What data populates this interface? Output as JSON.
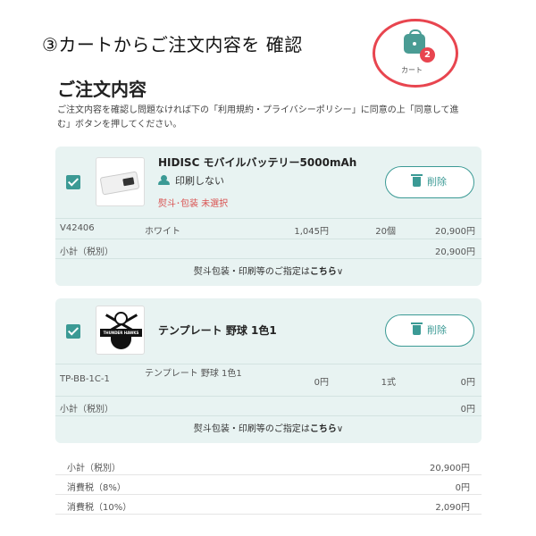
{
  "step_title": "③カートからご注文内容を 確認",
  "cart": {
    "badge_count": "2",
    "label": "カート"
  },
  "page": {
    "title": "ご注文内容",
    "description": "ご注文内容を確認し問題なければ下の「利用規約・プライバシーポリシー」に同意の上「同意して進む」ボタンを押してください。"
  },
  "items": [
    {
      "name": "HIDISC モバイルバッテリー5000mAh",
      "print_option": "印刷しない",
      "noshi": "熨斗･包装 未選択",
      "delete_label": "削除",
      "checked": true,
      "variant": {
        "code": "V42406",
        "color": "ホワイト",
        "unit_price": "1,045円",
        "quantity": "20個",
        "total": "20,900円"
      },
      "subtotal_label": "小計（税別）",
      "subtotal": "20,900円",
      "options_text": "熨斗包装・印刷等のご指定は",
      "options_link": "こちら",
      "thumbnail_icon": "power-bank-icon"
    },
    {
      "name": "テンプレート 野球 1色1",
      "delete_label": "削除",
      "checked": true,
      "variant": {
        "code": "TP-BB-1C-1",
        "color": "テンプレート 野球 1色1",
        "unit_price": "0円",
        "quantity": "1式",
        "total": "0円"
      },
      "subtotal_label": "小計（税別）",
      "subtotal": "0円",
      "options_text": "熨斗包装・印刷等のご指定は",
      "options_link": "こちら",
      "thumbnail_icon": "baseball-logo-icon",
      "logo_text": "THUNDER HAWKS"
    }
  ],
  "summary": [
    {
      "label": "小計（税別）",
      "value": "20,900円"
    },
    {
      "label": "消費税（8%）",
      "value": "0円"
    },
    {
      "label": "消費税（10%）",
      "value": "2,090円"
    }
  ],
  "colors": {
    "accent": "#3b9a95",
    "card_bg": "#e8f3f2",
    "alert": "#d9504f",
    "highlight_circle": "#e8454f"
  }
}
